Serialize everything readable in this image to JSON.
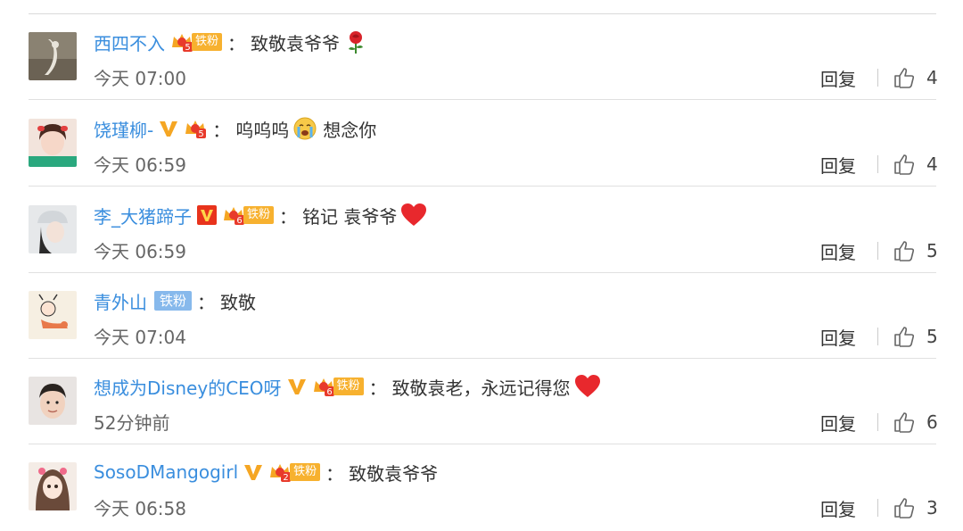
{
  "comments": [
    {
      "username": "西四不入",
      "verified": "",
      "fan_level": "5",
      "fan_label": "铁粉",
      "colon": "：",
      "text": "致敬袁爷爷",
      "emoji": "rose",
      "time": "今天 07:00",
      "reply_label": "回复",
      "likes": "4"
    },
    {
      "username": "饶瑾柳-",
      "verified": "gold",
      "fan_level": "5",
      "fan_label": "",
      "colon": "：",
      "text": "呜呜呜",
      "emoji": "crying",
      "text2": "想念你",
      "time": "今天 06:59",
      "reply_label": "回复",
      "likes": "4"
    },
    {
      "username": "李_大猪蹄子",
      "verified": "red",
      "fan_level": "6",
      "fan_label": "铁粉",
      "colon": "：",
      "text": "铭记 袁爷爷",
      "emoji": "heart",
      "time": "今天 06:59",
      "reply_label": "回复",
      "likes": "5"
    },
    {
      "username": "青外山",
      "verified": "",
      "fan_level": "",
      "fan_label": "铁粉",
      "colon": "：",
      "text": "致敬",
      "emoji": "",
      "time": "今天 07:04",
      "reply_label": "回复",
      "likes": "5"
    },
    {
      "username": "想成为Disney的CEO呀",
      "verified": "gold",
      "fan_level": "6",
      "fan_label": "铁粉",
      "colon": "：",
      "text": "致敬袁老，永远记得您",
      "emoji": "heart",
      "time": "52分钟前",
      "reply_label": "回复",
      "likes": "6"
    },
    {
      "username": "SosoDMangogirl",
      "verified": "gold",
      "fan_level": "2",
      "fan_label": "铁粉",
      "colon": "：",
      "text": "致敬袁爷爷",
      "emoji": "",
      "time": "今天 06:58",
      "reply_label": "回复",
      "likes": "3"
    }
  ],
  "colors": {
    "username": "#3a8ede",
    "fan_badge": "#f7b12f",
    "fan_badge_blue": "#87b9ec",
    "verified_gold": "#f7b12f",
    "verified_red": "#e8331c"
  }
}
